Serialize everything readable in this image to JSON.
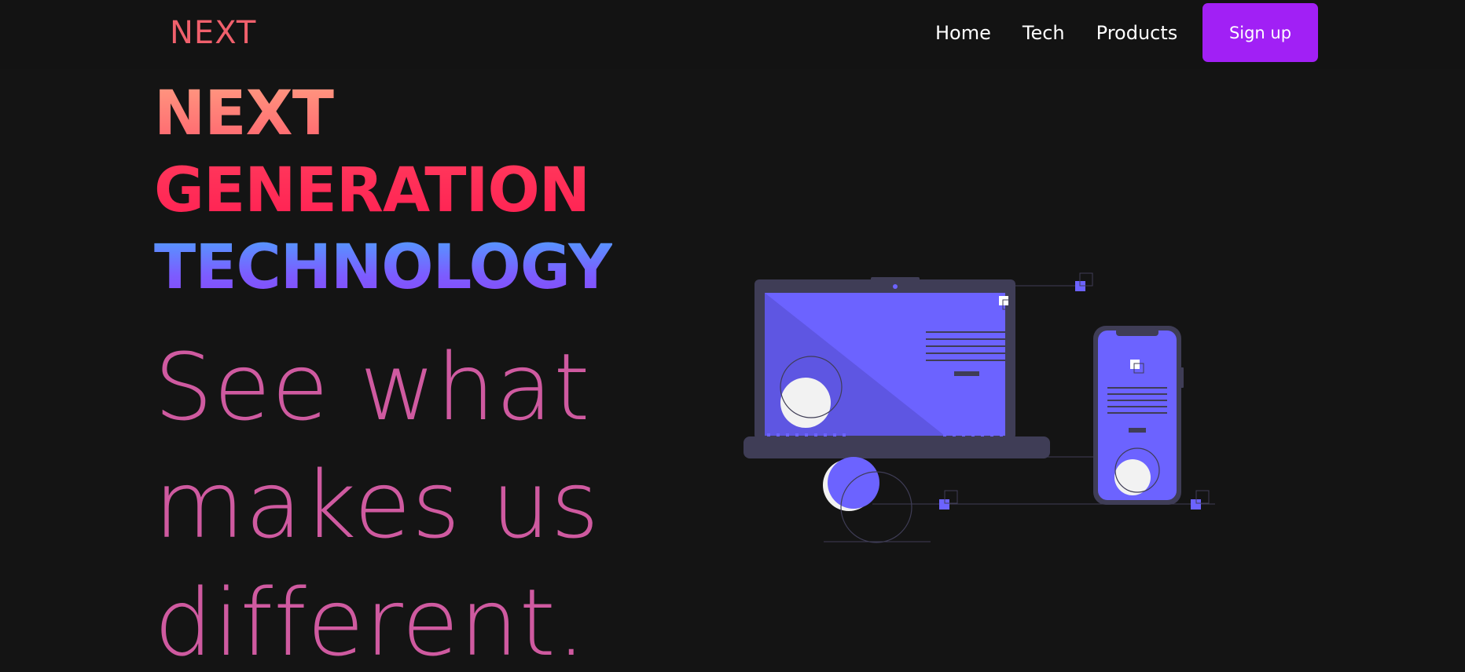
{
  "navbar": {
    "logo": "NEXT",
    "links": [
      "Home",
      "Tech",
      "Products"
    ],
    "signup_label": "Sign up"
  },
  "hero": {
    "headline": [
      "NEXT",
      "GENERATION",
      "TECHNOLOGY"
    ],
    "tagline": [
      "See what",
      "makes us",
      "different."
    ]
  },
  "colors": {
    "background": "#141414",
    "logo": "#f0606c",
    "signup_button": "#a120f5",
    "tagline": "#cf5aa0",
    "illustration_accent": "#6c63ff",
    "illustration_dark": "#3f3d56"
  },
  "illustration": {
    "icon": "devices-illustration-icon"
  }
}
